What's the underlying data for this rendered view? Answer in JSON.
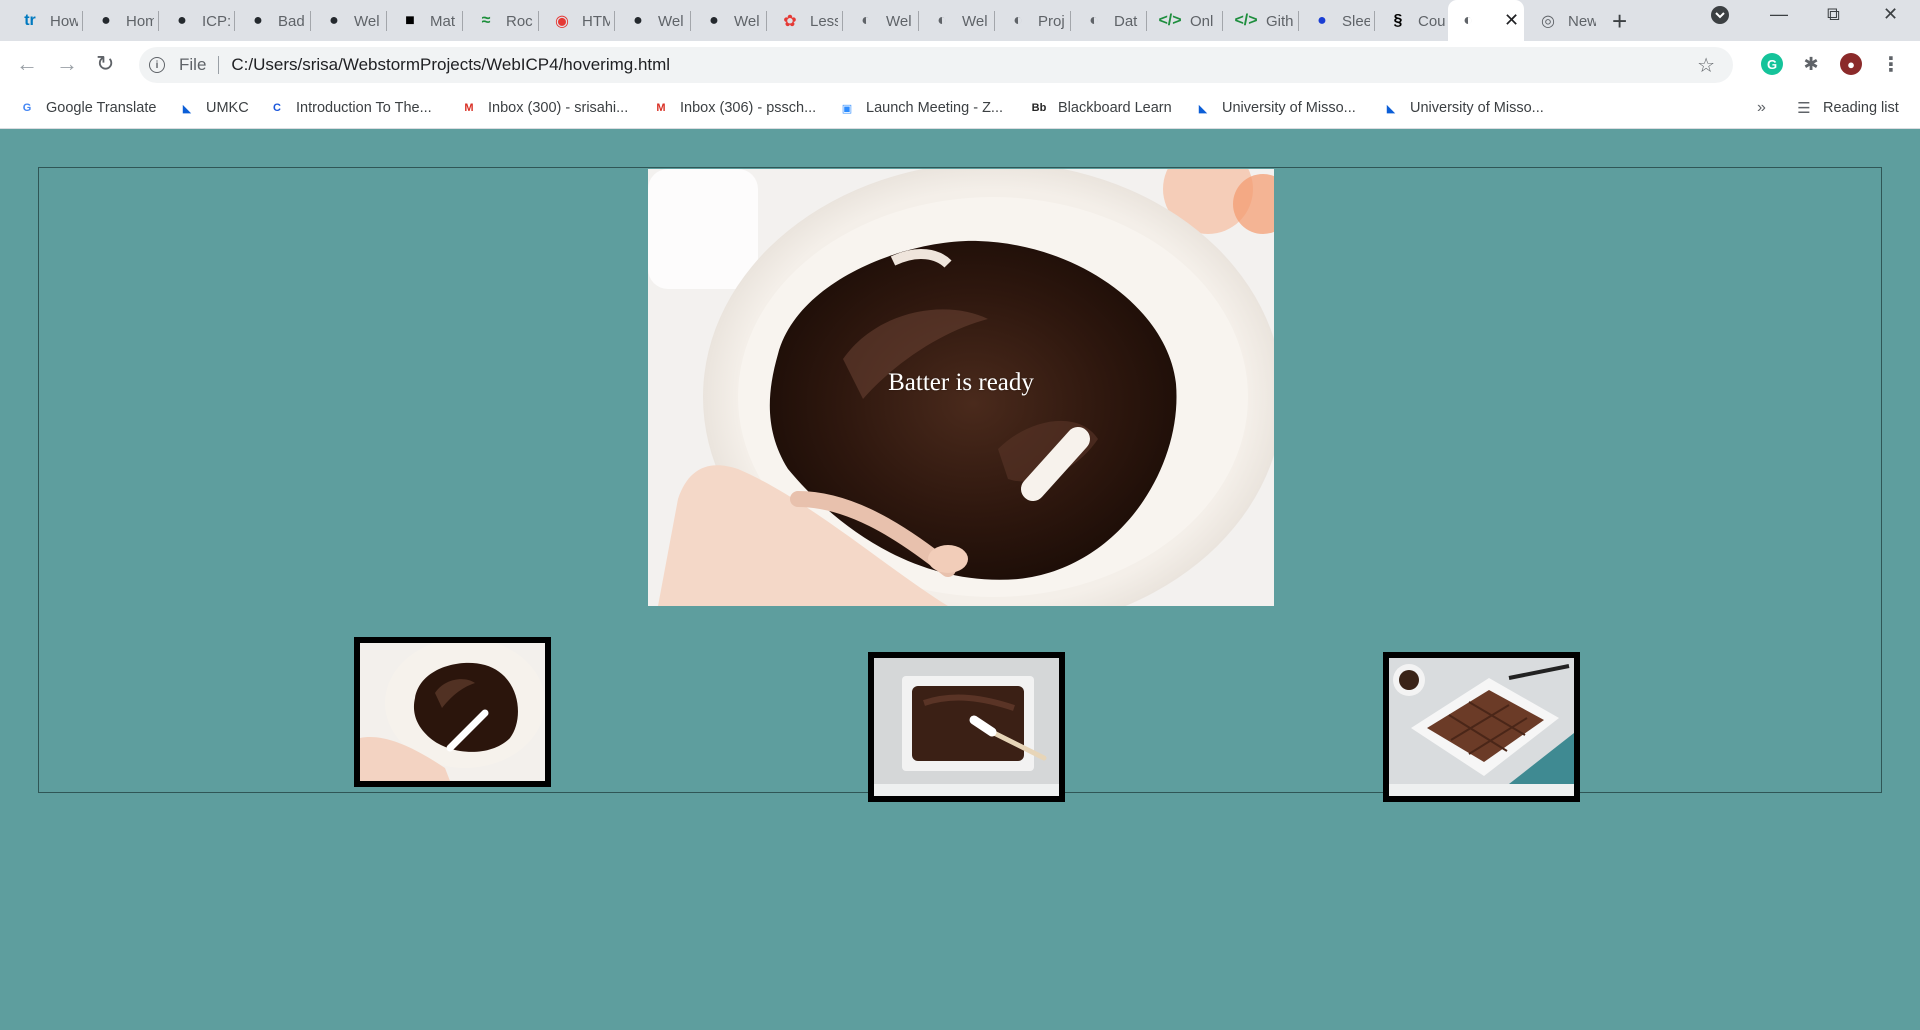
{
  "browser": {
    "tabs": [
      {
        "title": "How",
        "icon": "trello-icon",
        "color": "#0079bf",
        "glyph": "tr"
      },
      {
        "title": "Hom",
        "icon": "github-icon",
        "color": "#24292e",
        "glyph": "●"
      },
      {
        "title": "ICP:",
        "icon": "github-icon",
        "color": "#24292e",
        "glyph": "●"
      },
      {
        "title": "Bad",
        "icon": "github-icon",
        "color": "#24292e",
        "glyph": "●"
      },
      {
        "title": "Wel",
        "icon": "github-icon",
        "color": "#24292e",
        "glyph": "●"
      },
      {
        "title": "Mat",
        "icon": "mat-icon",
        "color": "#000000",
        "glyph": "■"
      },
      {
        "title": "Roc",
        "icon": "rocket-icon",
        "color": "#1b8e3a",
        "glyph": "≈"
      },
      {
        "title": "HTM",
        "icon": "html-icon",
        "color": "#e53935",
        "glyph": "◉"
      },
      {
        "title": "Wel",
        "icon": "github-icon",
        "color": "#24292e",
        "glyph": "●"
      },
      {
        "title": "Wel",
        "icon": "github-icon",
        "color": "#24292e",
        "glyph": "●"
      },
      {
        "title": "Less",
        "icon": "lesson-icon",
        "color": "#e53935",
        "glyph": "✿"
      },
      {
        "title": "Wel",
        "icon": "globe-icon",
        "color": "#5f6368",
        "glyph": "◐"
      },
      {
        "title": "Wel",
        "icon": "globe-icon",
        "color": "#5f6368",
        "glyph": "◐"
      },
      {
        "title": "Proj",
        "icon": "globe-icon",
        "color": "#5f6368",
        "glyph": "◐"
      },
      {
        "title": "Dat",
        "icon": "globe-icon",
        "color": "#5f6368",
        "glyph": "◐"
      },
      {
        "title": "Onl",
        "icon": "code-icon",
        "color": "#1e8e3e",
        "glyph": "</>"
      },
      {
        "title": "Gith",
        "icon": "code-icon",
        "color": "#1e8e3e",
        "glyph": "</>"
      },
      {
        "title": "Slee",
        "icon": "circle-icon",
        "color": "#1a3ed4",
        "glyph": "●"
      },
      {
        "title": "Cou",
        "icon": "course-icon",
        "color": "#000000",
        "glyph": "§"
      },
      {
        "title": "",
        "icon": "globe-icon",
        "color": "#5f6368",
        "glyph": "◐",
        "active": true
      },
      {
        "title": "New",
        "icon": "chrome-icon",
        "color": "#5f6368",
        "glyph": "◎"
      }
    ],
    "new_tab_label": "+",
    "address": {
      "scheme": "File",
      "url": "C:/Users/srisa/WebstormProjects/WebICP4/hoverimg.html"
    },
    "bookmarks": [
      {
        "label": "Google Translate",
        "icon": "translate-icon",
        "color": "#4285f4",
        "glyph": "G"
      },
      {
        "label": "UMKC",
        "icon": "umkc-icon",
        "color": "#0b5ed7",
        "glyph": "◣"
      },
      {
        "label": "Introduction To The...",
        "icon": "c-icon",
        "color": "#1a56db",
        "glyph": "C"
      },
      {
        "label": "Inbox (300) - srisahi...",
        "icon": "gmail-icon",
        "color": "#d93025",
        "glyph": "M"
      },
      {
        "label": "Inbox (306) - pssch...",
        "icon": "gmail-icon",
        "color": "#d93025",
        "glyph": "M"
      },
      {
        "label": "Launch Meeting - Z...",
        "icon": "zoom-icon",
        "color": "#2d8cff",
        "glyph": "▣"
      },
      {
        "label": "Blackboard Learn",
        "icon": "blackboard-icon",
        "color": "#262626",
        "glyph": "Bb"
      },
      {
        "label": "University of Misso...",
        "icon": "umkc-icon",
        "color": "#0b5ed7",
        "glyph": "◣"
      },
      {
        "label": "University of Misso...",
        "icon": "umkc-icon",
        "color": "#0b5ed7",
        "glyph": "◣"
      }
    ],
    "bookmarks_overflow": "»",
    "reading_list_label": "Reading list"
  },
  "page": {
    "background_color": "#5e9e9e",
    "main_caption": "Batter is ready",
    "thumbnails": [
      {
        "subject": "batter-bowl"
      },
      {
        "subject": "batter-pan"
      },
      {
        "subject": "baked-brownies"
      }
    ]
  }
}
